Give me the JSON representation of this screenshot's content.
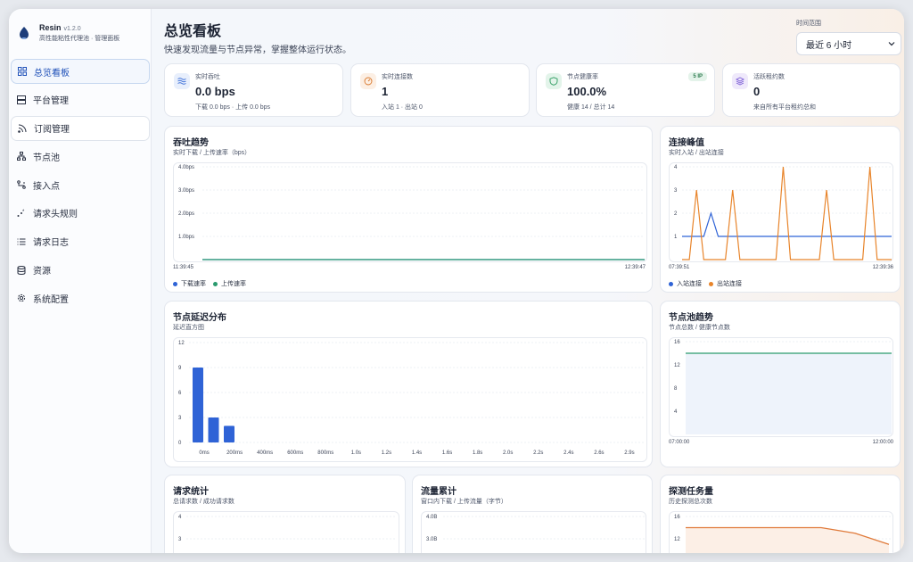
{
  "brand": {
    "name": "Resin",
    "version": "v1.2.0",
    "subtitle": "高性能粘性代理池 · 管理面板"
  },
  "nav": [
    {
      "label": "总览看板",
      "icon": "dashboard-icon",
      "active": true
    },
    {
      "label": "平台管理",
      "icon": "server-icon"
    },
    {
      "label": "订阅管理",
      "icon": "rss-icon"
    },
    {
      "label": "节点池",
      "icon": "network-icon"
    },
    {
      "label": "接入点",
      "icon": "route-icon"
    },
    {
      "label": "请求头规则",
      "icon": "rules-icon"
    },
    {
      "label": "请求日志",
      "icon": "list-icon"
    },
    {
      "label": "资源",
      "icon": "database-icon"
    },
    {
      "label": "系统配置",
      "icon": "gear-icon"
    }
  ],
  "header": {
    "title": "总览看板",
    "subtitle": "快速发现流量与节点异常，掌握整体运行状态。"
  },
  "time_range": {
    "label": "时间范围",
    "selected": "最近 6 小时"
  },
  "stats": [
    {
      "label": "实时吞吐",
      "value": "0.0 bps",
      "sub": "下载 0.0 bps · 上传 0.0 bps",
      "icon": "waves-icon",
      "color": "#3b6fd8"
    },
    {
      "label": "实时连接数",
      "value": "1",
      "sub": "入站 1 · 出站 0",
      "icon": "gauge-icon",
      "color": "#d9782c"
    },
    {
      "label": "节点健康率",
      "value": "100.0%",
      "sub": "健康 14 / 总计 14",
      "icon": "shield-icon",
      "color": "#2a9a5e",
      "badge": "5 IP"
    },
    {
      "label": "活跃租约数",
      "value": "0",
      "sub": "来自所有平台租约总和",
      "icon": "layers-icon",
      "color": "#7b5bd6"
    }
  ],
  "cards": {
    "throughput": {
      "title": "吞吐趋势",
      "subtitle": "实时下载 / 上传速率（bps）",
      "x_start": "11:39:45",
      "x_end": "12:39:47",
      "legend": [
        "下载速率",
        "上传速率"
      ]
    },
    "connections": {
      "title": "连接峰值",
      "subtitle": "实时入站 / 出站连接",
      "x_start": "07:39:51",
      "x_end": "12:39:36",
      "legend": [
        "入站连接",
        "出站连接"
      ]
    },
    "latency": {
      "title": "节点延迟分布",
      "subtitle": "延迟直方图"
    },
    "pool": {
      "title": "节点池趋势",
      "subtitle": "节点总数 / 健康节点数",
      "x_start": "07:00:00",
      "x_end": "12:00:00"
    },
    "requests": {
      "title": "请求统计",
      "subtitle": "总请求数 / 成功请求数"
    },
    "traffic": {
      "title": "流量累计",
      "subtitle": "窗口内下载 / 上传流量（字节）"
    },
    "probes": {
      "title": "探测任务量",
      "subtitle": "历史探测总次数"
    }
  },
  "chart_data": [
    {
      "type": "line",
      "title": "吞吐趋势",
      "ylim": [
        0,
        4.0
      ],
      "yticks": [
        "1.0bps",
        "2.0bps",
        "3.0bps",
        "4.0bps"
      ],
      "series": [
        {
          "name": "下载速率",
          "color": "#2f63d6",
          "values": [
            0,
            0
          ]
        },
        {
          "name": "上传速率",
          "color": "#2a9a6e",
          "values": [
            0,
            0
          ]
        }
      ]
    },
    {
      "type": "line",
      "title": "连接峰值",
      "ylim": [
        0,
        4
      ],
      "yticks": [
        "1",
        "2",
        "3",
        "4"
      ],
      "series": [
        {
          "name": "入站连接",
          "color": "#2f63d6",
          "values": [
            1,
            1,
            1,
            1,
            2,
            1,
            1,
            1,
            1,
            1,
            1,
            1,
            1,
            1,
            1,
            1,
            1,
            1,
            1,
            1,
            1,
            1,
            1,
            1,
            1,
            1,
            1,
            1,
            1,
            1
          ]
        },
        {
          "name": "出站连接",
          "color": "#e8842a",
          "values": [
            0,
            0,
            3,
            0,
            0,
            0,
            0,
            3,
            0,
            0,
            0,
            0,
            0,
            0,
            4,
            0,
            0,
            0,
            0,
            0,
            3,
            0,
            0,
            0,
            0,
            0,
            4,
            0,
            0,
            0
          ]
        }
      ]
    },
    {
      "type": "bar",
      "title": "节点延迟分布",
      "ylim": [
        0,
        12
      ],
      "yticks": [
        "0",
        "3",
        "6",
        "9",
        "12"
      ],
      "categories": [
        "0ms",
        "200ms",
        "400ms",
        "600ms",
        "800ms",
        "1.0s",
        "1.2s",
        "1.4s",
        "1.6s",
        "1.8s",
        "2.0s",
        "2.2s",
        "2.4s",
        "2.6s",
        "2.9s"
      ],
      "values": [
        9,
        3,
        2,
        0,
        0,
        0,
        0,
        0,
        0,
        0,
        0,
        0,
        0,
        0,
        0
      ]
    },
    {
      "type": "area",
      "title": "节点池趋势",
      "ylim": [
        0,
        16
      ],
      "yticks": [
        "4",
        "8",
        "12",
        "16"
      ],
      "series": [
        {
          "name": "健康节点数",
          "color": "#2a9a6e",
          "values": [
            14,
            14
          ]
        }
      ]
    },
    {
      "type": "line",
      "title": "请求统计",
      "yticks": [
        "3",
        "4"
      ]
    },
    {
      "type": "line",
      "title": "流量累计",
      "yticks": [
        "3.0B",
        "4.0B"
      ]
    },
    {
      "type": "line",
      "title": "探测任务量",
      "yticks": [
        "12",
        "16"
      ],
      "series": [
        {
          "values": [
            14,
            14,
            14,
            14,
            14,
            13,
            11
          ]
        }
      ]
    }
  ]
}
